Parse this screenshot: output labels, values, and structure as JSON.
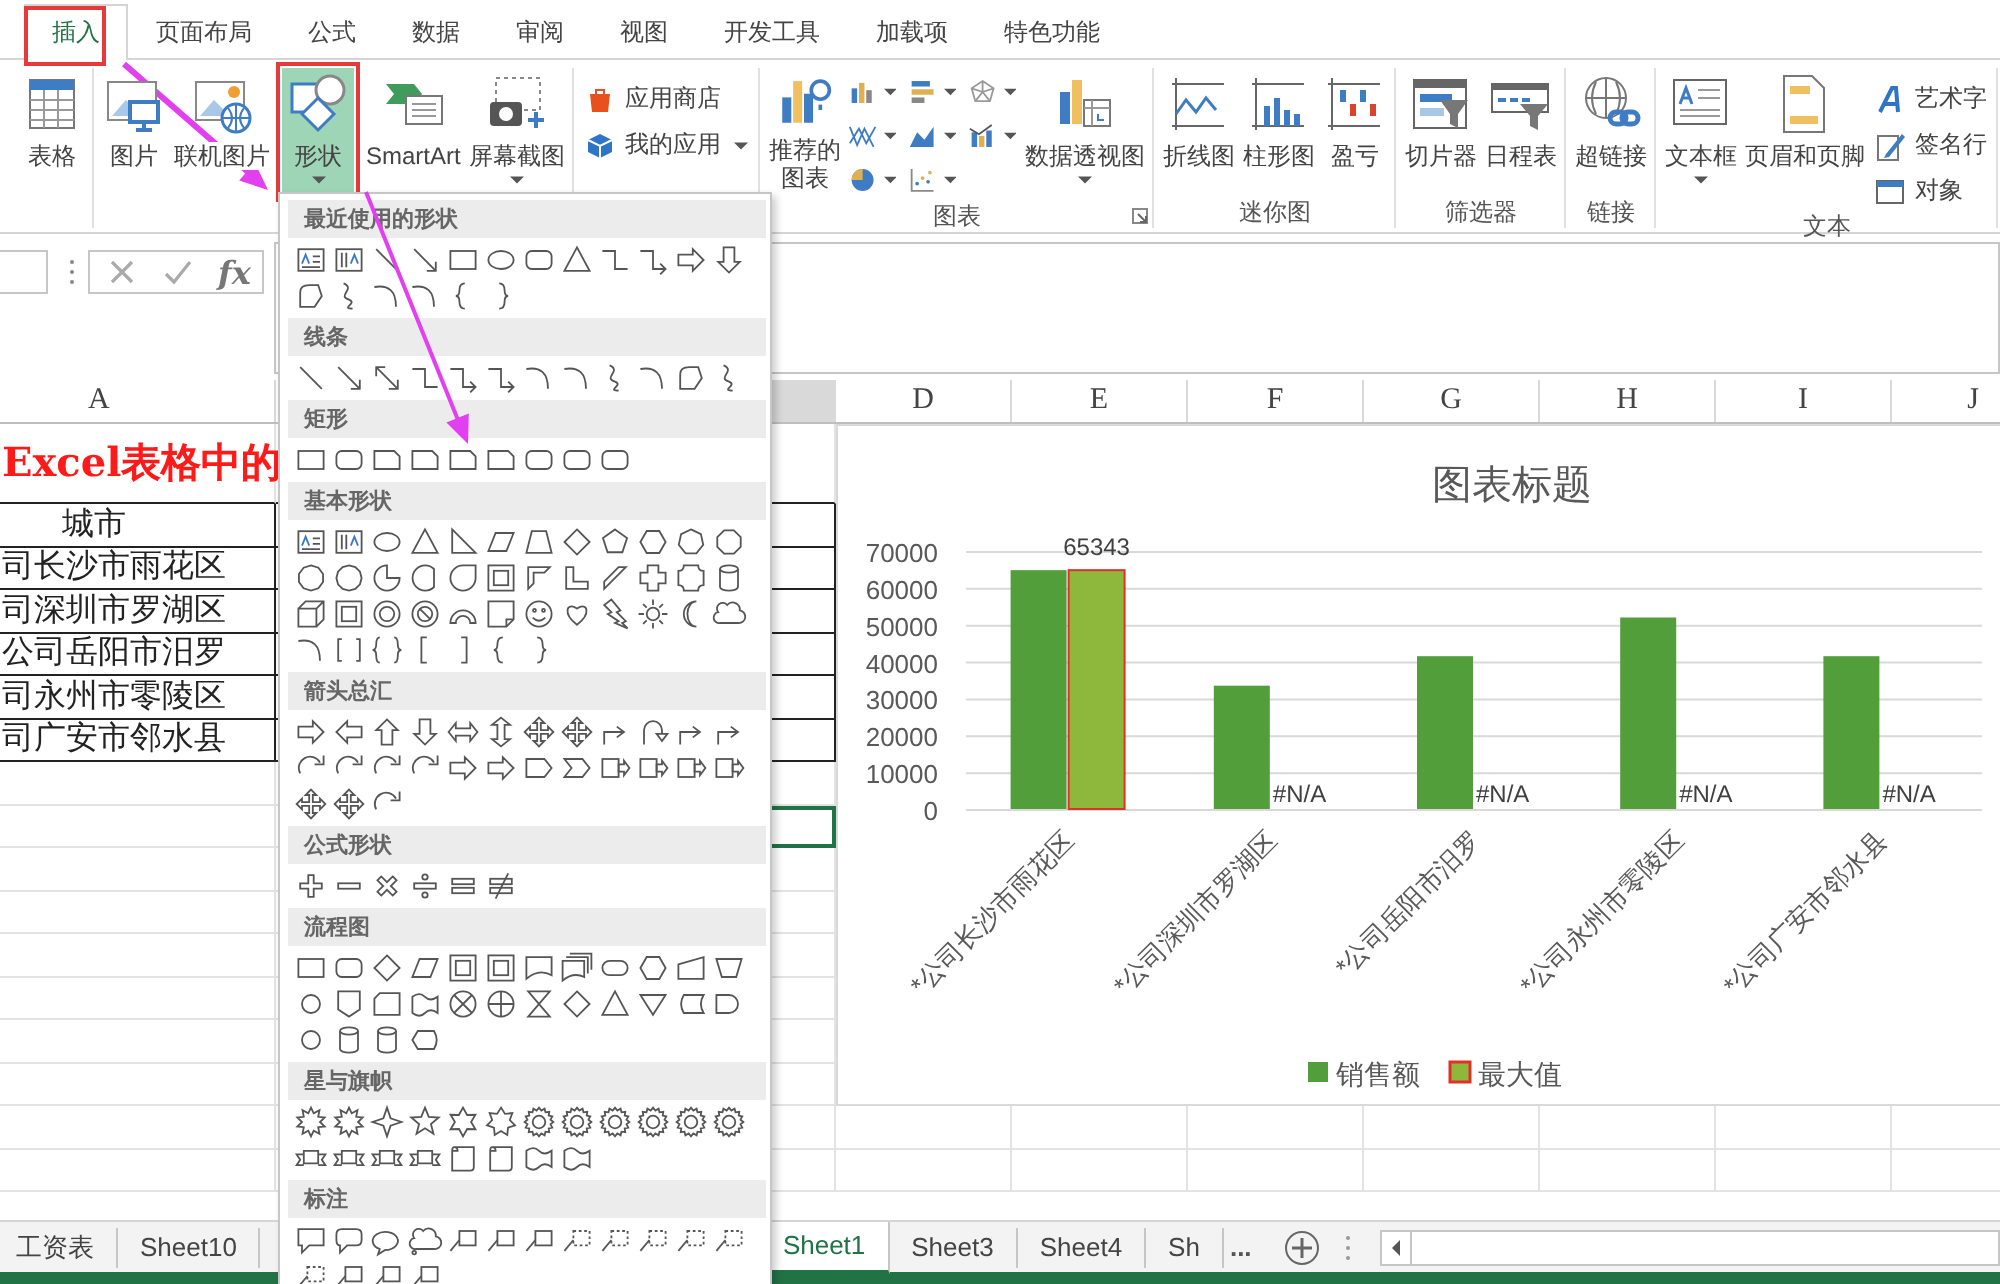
{
  "tabs": [
    {
      "label": "插入",
      "selected": true
    },
    {
      "label": "页面布局",
      "selected": false
    },
    {
      "label": "公式",
      "selected": false
    },
    {
      "label": "数据",
      "selected": false
    },
    {
      "label": "审阅",
      "selected": false
    },
    {
      "label": "视图",
      "selected": false
    },
    {
      "label": "开发工具",
      "selected": false
    },
    {
      "label": "加载项",
      "selected": false
    },
    {
      "label": "特色功能",
      "selected": false
    }
  ],
  "ribbon": {
    "groups": [
      {
        "launcher": false,
        "buttons": [
          {
            "kind": "large",
            "label": "表格",
            "pressed": false,
            "dropdown": false
          }
        ]
      },
      {
        "launcher": false,
        "buttons": [
          {
            "kind": "large",
            "label": "图片",
            "pressed": false,
            "dropdown": false
          },
          {
            "kind": "large",
            "label": "联机图片",
            "pressed": false,
            "dropdown": false
          },
          {
            "kind": "large",
            "label": "形状",
            "pressed": true,
            "dropdown": true
          },
          {
            "kind": "large",
            "label": "SmartArt",
            "pressed": false,
            "dropdown": false
          },
          {
            "kind": "large",
            "label": "屏幕截图",
            "pressed": false,
            "dropdown": true
          }
        ]
      },
      {
        "launcher": false,
        "buttons": [
          {
            "kind": "small",
            "label": "应用商店",
            "pressed": false,
            "dropdown": false
          },
          {
            "kind": "small",
            "label": "我的应用",
            "pressed": false,
            "dropdown": true
          }
        ]
      },
      {
        "label": "图表",
        "launcher": true,
        "buttons": [
          {
            "kind": "stacked",
            "label": "推荐的图表",
            "pressed": false,
            "dropdown": false
          },
          {
            "kind": "icon",
            "pressed": false,
            "dropdown": true
          },
          {
            "kind": "icon",
            "pressed": false,
            "dropdown": true
          },
          {
            "kind": "icon",
            "pressed": false,
            "dropdown": true
          },
          {
            "kind": "icon",
            "pressed": false,
            "dropdown": true
          },
          {
            "kind": "icon",
            "pressed": false,
            "dropdown": true
          },
          {
            "kind": "icon",
            "pressed": false,
            "dropdown": true
          },
          {
            "kind": "icon",
            "pressed": false,
            "dropdown": true
          },
          {
            "kind": "icon",
            "pressed": false,
            "dropdown": true
          },
          {
            "kind": "large",
            "label": "数据透视图",
            "pressed": false,
            "dropdown": true
          }
        ]
      },
      {
        "label": "迷你图",
        "launcher": false,
        "buttons": [
          {
            "kind": "large",
            "label": "折线图",
            "pressed": false,
            "dropdown": false
          },
          {
            "kind": "large",
            "label": "柱形图",
            "pressed": false,
            "dropdown": false
          },
          {
            "kind": "large",
            "label": "盈亏",
            "pressed": false,
            "dropdown": false
          }
        ]
      },
      {
        "label": "筛选器",
        "launcher": false,
        "buttons": [
          {
            "kind": "large",
            "label": "切片器",
            "pressed": false,
            "dropdown": false
          },
          {
            "kind": "large",
            "label": "日程表",
            "pressed": false,
            "dropdown": false
          }
        ]
      },
      {
        "label": "链接",
        "launcher": false,
        "buttons": [
          {
            "kind": "large",
            "label": "超链接",
            "pressed": false,
            "dropdown": false
          }
        ]
      },
      {
        "label": "文本",
        "launcher": false,
        "buttons": [
          {
            "kind": "large",
            "label": "文本框",
            "pressed": false,
            "dropdown": true
          },
          {
            "kind": "large",
            "label": "页眉和页脚",
            "pressed": false,
            "dropdown": false
          },
          {
            "kind": "small",
            "label": "艺术字",
            "pressed": false,
            "dropdown": false
          },
          {
            "kind": "small",
            "label": "签名行",
            "pressed": false,
            "dropdown": false
          },
          {
            "kind": "small",
            "label": "对象",
            "pressed": false,
            "dropdown": false
          }
        ]
      }
    ]
  },
  "formula_bar": {
    "function_symbol": "fx"
  },
  "sheet": {
    "columns": [
      "A",
      "D",
      "E",
      "F",
      "G",
      "H",
      "I",
      "J"
    ],
    "rows": [
      {
        "kind": "title",
        "text": "Excel表格中的",
        "selected": false
      },
      {
        "kind": "header",
        "text": "城市",
        "selected": false
      },
      {
        "kind": "data",
        "text": "司长沙市雨花区",
        "selected": false
      },
      {
        "kind": "data",
        "text": "司深圳市罗湖区",
        "selected": false
      },
      {
        "kind": "data",
        "text": "公司岳阳市汨罗",
        "selected": false
      },
      {
        "kind": "data",
        "text": "司永州市零陵区",
        "selected": false
      },
      {
        "kind": "data",
        "text": "司广安市邻水县",
        "selected": false
      },
      {
        "kind": "empty",
        "selected": false
      },
      {
        "kind": "empty",
        "selected": true
      },
      {
        "kind": "empty",
        "selected": false
      },
      {
        "kind": "empty",
        "selected": false
      },
      {
        "kind": "empty",
        "selected": false
      },
      {
        "kind": "empty",
        "selected": false
      },
      {
        "kind": "empty",
        "selected": false
      },
      {
        "kind": "empty",
        "selected": false
      },
      {
        "kind": "empty",
        "selected": false
      },
      {
        "kind": "empty",
        "selected": false
      }
    ]
  },
  "chart": {
    "chart_data": {
      "type": "bar",
      "title": "图表标题",
      "categories": [
        "*公司长沙市雨花区",
        "*公司深圳市罗湖区",
        "*公司岳阳市汨罗",
        "*公司永州市零陵区",
        "*公司广安市邻水县"
      ],
      "series": [
        {
          "name": "销售额",
          "color": "#519e3a",
          "values": [
            65343,
            34000,
            42000,
            52500,
            42000
          ]
        },
        {
          "name": "最大值",
          "color": "#8db83b",
          "values": [
            65343,
            null,
            null,
            null,
            null
          ]
        }
      ],
      "ylim": [
        0,
        70000
      ],
      "yticks": [
        0,
        10000,
        20000,
        30000,
        40000,
        50000,
        60000,
        70000
      ],
      "grid": true,
      "legend": true,
      "value_labels": [
        "65343",
        "#N/A",
        "#N/A",
        "#N/A",
        "#N/A"
      ]
    }
  },
  "shapes_menu": {
    "sections": [
      {
        "title": "最近使用的形状"
      },
      {
        "title": "线条"
      },
      {
        "title": "矩形"
      },
      {
        "title": "基本形状"
      },
      {
        "title": "箭头总汇"
      },
      {
        "title": "公式形状"
      },
      {
        "title": "流程图"
      },
      {
        "title": "星与旗帜"
      },
      {
        "title": "标注"
      }
    ]
  },
  "sheet_tabs": [
    {
      "label": "工资表",
      "selected": false
    },
    {
      "label": "Sheet10",
      "selected": false
    },
    {
      "label": "Sheet1",
      "selected": true
    },
    {
      "label": "Sheet3",
      "selected": false
    },
    {
      "label": "Sheet4",
      "selected": false
    },
    {
      "label": "Sh",
      "selected": false
    }
  ],
  "more_tabs": "..."
}
